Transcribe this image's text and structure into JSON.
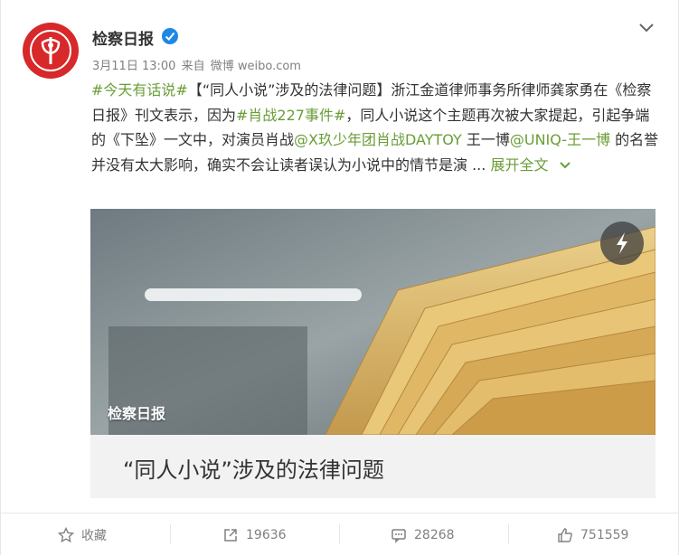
{
  "author": {
    "name": "检察日报",
    "avatar_text": "检察日报"
  },
  "meta": {
    "date": "3月11日 13:00",
    "from": "来自",
    "source": "微博 weibo.com"
  },
  "post": {
    "tag1": "#今天有话说#",
    "t1": "【“同人小说”涉及的法律问题】浙江金道律师事务所律师龚家勇在《检察日报》刊文表示，因为",
    "tag2": "#肖战227事件#",
    "t2": "，同人小说这个主题再次被大家提起，引起争端的《下坠》一文中，对演员肖战",
    "at1": "@X玖少年团肖战DAYTOY",
    "t3": " 王一博",
    "at2": "@UNIQ-王一博",
    "t4": " 的名誉并没有太大影响，确实不会让读者误认为小说中的情节是演 ... ",
    "more": "展开全文"
  },
  "media": {
    "source_label": "检察日报",
    "title": "“同人小说”涉及的法律问题"
  },
  "actions": {
    "favorite": "收藏",
    "repost": "19636",
    "comment": "28268",
    "like": "751559"
  },
  "colors": {
    "link": "#eb7350",
    "tag": "#6a9d37",
    "brand": "#d7282a"
  }
}
